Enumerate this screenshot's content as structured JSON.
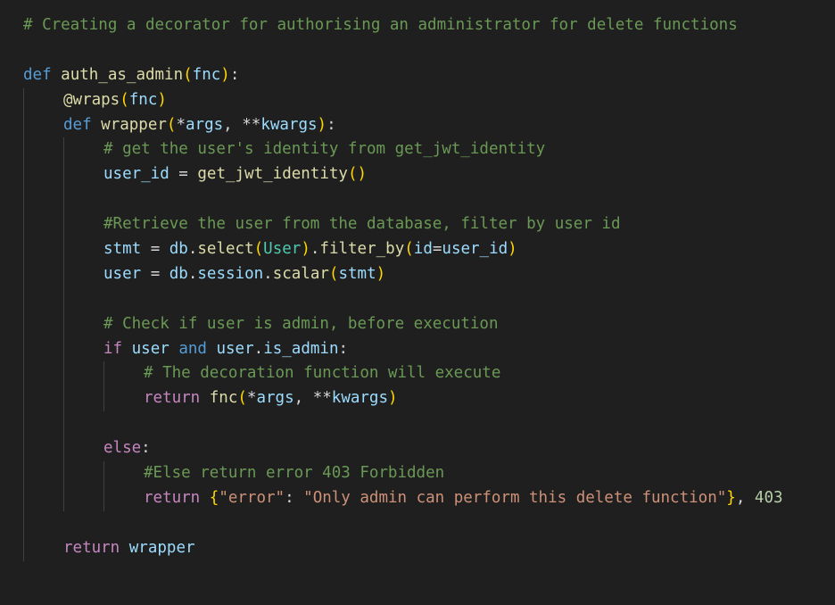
{
  "editor": {
    "background": "#1f1f1f",
    "language": "python",
    "lines": [
      {
        "indent": 0,
        "tokens": [
          {
            "t": "# Creating a decorator for authorising an administrator for delete functions",
            "c": "comment"
          }
        ]
      },
      {
        "indent": 0,
        "tokens": []
      },
      {
        "indent": 0,
        "tokens": [
          {
            "t": "def",
            "c": "keyword"
          },
          {
            "t": " ",
            "c": "op"
          },
          {
            "t": "auth_as_admin",
            "c": "func"
          },
          {
            "t": "(",
            "c": "b1"
          },
          {
            "t": "fnc",
            "c": "param"
          },
          {
            "t": ")",
            "c": "b1"
          },
          {
            "t": ":",
            "c": "punct"
          }
        ]
      },
      {
        "indent": 1,
        "tokens": [
          {
            "t": "@wraps",
            "c": "func"
          },
          {
            "t": "(",
            "c": "b1"
          },
          {
            "t": "fnc",
            "c": "var"
          },
          {
            "t": ")",
            "c": "b1"
          }
        ]
      },
      {
        "indent": 1,
        "tokens": [
          {
            "t": "def",
            "c": "keyword"
          },
          {
            "t": " ",
            "c": "op"
          },
          {
            "t": "wrapper",
            "c": "func"
          },
          {
            "t": "(",
            "c": "b1"
          },
          {
            "t": "*",
            "c": "op"
          },
          {
            "t": "args",
            "c": "param"
          },
          {
            "t": ", ",
            "c": "punct"
          },
          {
            "t": "**",
            "c": "op"
          },
          {
            "t": "kwargs",
            "c": "param"
          },
          {
            "t": ")",
            "c": "b1"
          },
          {
            "t": ":",
            "c": "punct"
          }
        ]
      },
      {
        "indent": 2,
        "tokens": [
          {
            "t": "# get the user's identity from get_jwt_identity",
            "c": "comment"
          }
        ]
      },
      {
        "indent": 2,
        "tokens": [
          {
            "t": "user_id",
            "c": "var"
          },
          {
            "t": " = ",
            "c": "op"
          },
          {
            "t": "get_jwt_identity",
            "c": "func"
          },
          {
            "t": "(",
            "c": "b1"
          },
          {
            "t": ")",
            "c": "b1"
          }
        ]
      },
      {
        "indent": 2,
        "tokens": []
      },
      {
        "indent": 2,
        "tokens": [
          {
            "t": "#Retrieve the user from the database, filter by user id",
            "c": "comment"
          }
        ]
      },
      {
        "indent": 2,
        "tokens": [
          {
            "t": "stmt",
            "c": "var"
          },
          {
            "t": " = ",
            "c": "op"
          },
          {
            "t": "db",
            "c": "var"
          },
          {
            "t": ".",
            "c": "punct"
          },
          {
            "t": "select",
            "c": "func"
          },
          {
            "t": "(",
            "c": "b1"
          },
          {
            "t": "User",
            "c": "cls"
          },
          {
            "t": ")",
            "c": "b1"
          },
          {
            "t": ".",
            "c": "punct"
          },
          {
            "t": "filter_by",
            "c": "func"
          },
          {
            "t": "(",
            "c": "b1"
          },
          {
            "t": "id",
            "c": "param"
          },
          {
            "t": "=",
            "c": "op"
          },
          {
            "t": "user_id",
            "c": "var"
          },
          {
            "t": ")",
            "c": "b1"
          }
        ]
      },
      {
        "indent": 2,
        "tokens": [
          {
            "t": "user",
            "c": "var"
          },
          {
            "t": " = ",
            "c": "op"
          },
          {
            "t": "db",
            "c": "var"
          },
          {
            "t": ".",
            "c": "punct"
          },
          {
            "t": "session",
            "c": "var"
          },
          {
            "t": ".",
            "c": "punct"
          },
          {
            "t": "scalar",
            "c": "func"
          },
          {
            "t": "(",
            "c": "b1"
          },
          {
            "t": "stmt",
            "c": "var"
          },
          {
            "t": ")",
            "c": "b1"
          }
        ]
      },
      {
        "indent": 2,
        "tokens": []
      },
      {
        "indent": 2,
        "tokens": [
          {
            "t": "# Check if user is admin, before execution",
            "c": "comment"
          }
        ]
      },
      {
        "indent": 2,
        "tokens": [
          {
            "t": "if",
            "c": "control"
          },
          {
            "t": " ",
            "c": "op"
          },
          {
            "t": "user",
            "c": "var"
          },
          {
            "t": " ",
            "c": "op"
          },
          {
            "t": "and",
            "c": "keyword"
          },
          {
            "t": " ",
            "c": "op"
          },
          {
            "t": "user",
            "c": "var"
          },
          {
            "t": ".",
            "c": "punct"
          },
          {
            "t": "is_admin",
            "c": "var"
          },
          {
            "t": ":",
            "c": "punct"
          }
        ]
      },
      {
        "indent": 3,
        "tokens": [
          {
            "t": "# The decoration function will execute",
            "c": "comment"
          }
        ]
      },
      {
        "indent": 3,
        "tokens": [
          {
            "t": "return",
            "c": "control"
          },
          {
            "t": " ",
            "c": "op"
          },
          {
            "t": "fnc",
            "c": "func"
          },
          {
            "t": "(",
            "c": "b1"
          },
          {
            "t": "*",
            "c": "op"
          },
          {
            "t": "args",
            "c": "var"
          },
          {
            "t": ", ",
            "c": "punct"
          },
          {
            "t": "**",
            "c": "op"
          },
          {
            "t": "kwargs",
            "c": "var"
          },
          {
            "t": ")",
            "c": "b1"
          }
        ]
      },
      {
        "indent": 2,
        "tokens": []
      },
      {
        "indent": 2,
        "tokens": [
          {
            "t": "else",
            "c": "control"
          },
          {
            "t": ":",
            "c": "punct"
          }
        ]
      },
      {
        "indent": 3,
        "tokens": [
          {
            "t": "#Else return error 403 Forbidden",
            "c": "comment"
          }
        ]
      },
      {
        "indent": 3,
        "tokens": [
          {
            "t": "return",
            "c": "control"
          },
          {
            "t": " ",
            "c": "op"
          },
          {
            "t": "{",
            "c": "b1"
          },
          {
            "t": "\"error\"",
            "c": "str"
          },
          {
            "t": ": ",
            "c": "punct"
          },
          {
            "t": "\"Only admin can perform this delete function\"",
            "c": "str"
          },
          {
            "t": "}",
            "c": "b1"
          },
          {
            "t": ", ",
            "c": "punct"
          },
          {
            "t": "403",
            "c": "num"
          }
        ]
      },
      {
        "indent": 1,
        "tokens": []
      },
      {
        "indent": 1,
        "tokens": [
          {
            "t": "return",
            "c": "control"
          },
          {
            "t": " ",
            "c": "op"
          },
          {
            "t": "wrapper",
            "c": "var"
          }
        ]
      }
    ],
    "guides": [
      {
        "level": 0,
        "from": 3,
        "to": 21
      },
      {
        "level": 1,
        "from": 5,
        "to": 19
      },
      {
        "level": 2,
        "from": 14,
        "to": 15
      },
      {
        "level": 2,
        "from": 18,
        "to": 19
      }
    ]
  }
}
